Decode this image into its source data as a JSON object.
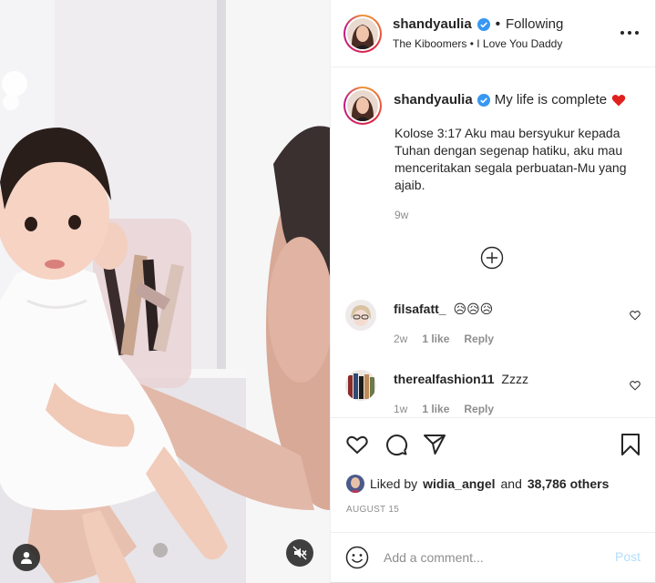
{
  "header": {
    "username": "shandyaulia",
    "separator": "•",
    "follow_state": "Following",
    "audio": "The Kiboomers • I Love You Daddy"
  },
  "caption": {
    "username": "shandyaulia",
    "text": "My life is complete",
    "body": "Kolose 3:17 Aku mau bersyukur kepada Tuhan dengan segenap hatiku, aku mau menceritakan segala perbuatan-Mu yang ajaib.",
    "time": "9w"
  },
  "comments": [
    {
      "username": "filsafatt_",
      "text": "😥😥😥",
      "time": "2w",
      "likes": "1 like",
      "reply": "Reply"
    },
    {
      "username": "therealfashion11",
      "text": "Zzzz",
      "time": "1w",
      "likes": "1 like",
      "reply": "Reply"
    }
  ],
  "likes": {
    "prefix": "Liked by",
    "user": "widia_angel",
    "middle": "and",
    "others": "38,786 others"
  },
  "date": "AUGUST 15",
  "add_comment": {
    "placeholder": "Add a comment...",
    "post_label": "Post"
  },
  "colors": {
    "verified": "#3897f0",
    "post_disabled": "#b2dffc",
    "secondary_text": "#8e8e8e",
    "heart": "#ed4956"
  },
  "icons": {
    "more": "more-options-icon",
    "load_more": "plus-circle-icon",
    "like": "heart-outline-icon",
    "comment": "comment-bubble-icon",
    "share": "paper-plane-icon",
    "save": "bookmark-icon",
    "emoji": "smiley-icon",
    "tags": "user-tag-icon",
    "audio": "speaker-muted-icon"
  }
}
